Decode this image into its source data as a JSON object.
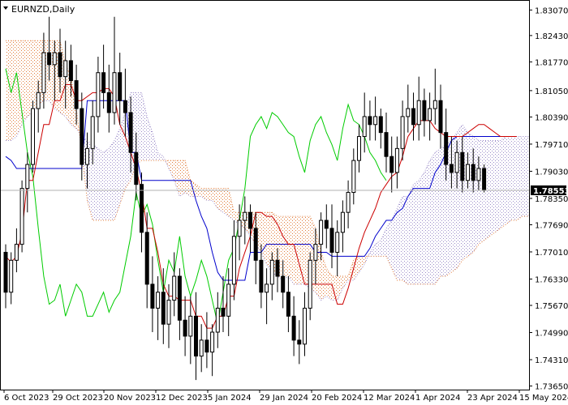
{
  "chart_data": {
    "type": "line",
    "title": "EURNZD,Daily",
    "symbol": "EURNZD",
    "timeframe": "Daily",
    "ylim": [
      1.7356,
      1.833
    ],
    "y_ticks": [
      "1.83070",
      "1.82430",
      "1.81770",
      "1.81050",
      "1.80390",
      "1.79710",
      "1.79030",
      "1.78350",
      "1.77690",
      "1.77010",
      "1.76330",
      "1.75670",
      "1.74990",
      "1.74310",
      "1.73650"
    ],
    "x_ticks": [
      "6 Oct 2023",
      "29 Oct 2023",
      "20 Nov 2023",
      "12 Dec 2023",
      "5 Jan 2024",
      "29 Jan 2024",
      "20 Feb 2024",
      "12 Mar 2024",
      "1 Apr 2024",
      "23 Apr 2024",
      "15 May 2024"
    ],
    "current_price": "1.78553",
    "colors": {
      "candle": "#000000",
      "tenkan_sen": "#cc0000",
      "kijun_sen": "#0000cc",
      "chikou_span": "#00cc00",
      "cloud_up": "#e07b39",
      "cloud_down": "#9a8ac8",
      "price_line": "#b0b0b0",
      "price_label_bg": "#000000"
    },
    "series": [
      {
        "key": "tenkan_sen",
        "values": [
          1.769,
          1.7675,
          1.769,
          1.775,
          1.788,
          1.788,
          1.795,
          1.802,
          1.802,
          1.808,
          1.808,
          1.812,
          1.812,
          1.808,
          1.808,
          1.809,
          1.81,
          1.81,
          1.811,
          1.811,
          1.809,
          1.802,
          1.799,
          1.795,
          1.791,
          1.785,
          1.776,
          1.776,
          1.77,
          1.762,
          1.759,
          1.759,
          1.758,
          1.758,
          1.758,
          1.754,
          1.754,
          1.751,
          1.751,
          1.754,
          1.754,
          1.759,
          1.759,
          1.766,
          1.77,
          1.774,
          1.78,
          1.78,
          1.779,
          1.779,
          1.777,
          1.774,
          1.772,
          1.772,
          1.767,
          1.762,
          1.762,
          1.762,
          1.762,
          1.762,
          1.762,
          1.757,
          1.757,
          1.761,
          1.766,
          1.771,
          1.775,
          1.778,
          1.781,
          1.785,
          1.787,
          1.789,
          1.79,
          1.794,
          1.799,
          1.801,
          1.803,
          1.803,
          1.803,
          1.801,
          1.8,
          1.799,
          1.799,
          1.799,
          1.799,
          1.8,
          1.801,
          1.802,
          1.802,
          1.801,
          1.8,
          1.799,
          1.799,
          1.799,
          1.799
        ]
      },
      {
        "key": "kijun_sen",
        "values": [
          1.794,
          1.793,
          1.791,
          1.791,
          1.791,
          1.791,
          1.791,
          1.791,
          1.791,
          1.791,
          1.791,
          1.791,
          1.791,
          1.791,
          1.791,
          1.808,
          1.808,
          1.808,
          1.808,
          1.808,
          1.808,
          1.808,
          1.808,
          1.795,
          1.795,
          1.788,
          1.788,
          1.788,
          1.788,
          1.788,
          1.788,
          1.788,
          1.788,
          1.788,
          1.788,
          1.783,
          1.779,
          1.776,
          1.77,
          1.765,
          1.763,
          1.763,
          1.763,
          1.763,
          1.763,
          1.77,
          1.77,
          1.77,
          1.772,
          1.772,
          1.772,
          1.772,
          1.772,
          1.772,
          1.772,
          1.772,
          1.772,
          1.77,
          1.77,
          1.77,
          1.769,
          1.769,
          1.769,
          1.769,
          1.769,
          1.769,
          1.769,
          1.771,
          1.774,
          1.776,
          1.778,
          1.778,
          1.78,
          1.781,
          1.784,
          1.786,
          1.786,
          1.786,
          1.786,
          1.79,
          1.792,
          1.795,
          1.798,
          1.799,
          1.799,
          1.799,
          1.799,
          1.799,
          1.799,
          1.799,
          1.799,
          1.799,
          1.799,
          1.799,
          1.799
        ]
      },
      {
        "key": "chikou_span",
        "values": [
          1.816,
          1.81,
          1.815,
          1.805,
          1.795,
          1.789,
          1.776,
          1.764,
          1.757,
          1.758,
          1.762,
          1.754,
          1.758,
          1.762,
          1.76,
          1.754,
          1.754,
          1.757,
          1.76,
          1.755,
          1.758,
          1.76,
          1.767,
          1.774,
          1.785,
          1.779,
          1.782,
          1.777,
          1.768,
          1.76,
          1.768,
          1.765,
          1.774,
          1.764,
          1.759,
          1.763,
          1.768,
          1.764,
          1.758,
          1.752,
          1.76,
          1.768,
          1.771,
          1.778,
          1.786,
          1.799,
          1.802,
          1.804,
          1.801,
          1.805,
          1.804,
          1.802,
          1.8,
          1.799,
          1.794,
          1.79,
          1.798,
          1.802,
          1.804,
          1.8,
          1.797,
          1.793,
          1.801,
          1.807,
          1.803,
          1.802,
          1.799,
          1.795,
          1.793,
          1.79,
          1.788
        ]
      },
      {
        "key": "senkou_a",
        "values": [
          1.798,
          1.798,
          1.799,
          1.802,
          1.804,
          1.805,
          1.807,
          1.808,
          1.808,
          1.806,
          1.805,
          1.804,
          1.802,
          1.801,
          1.799,
          1.798,
          1.797,
          1.796,
          1.795,
          1.796,
          1.798,
          1.801,
          1.805,
          1.81,
          1.81,
          1.81,
          1.804,
          1.8,
          1.795,
          1.794,
          1.791,
          1.788,
          1.784,
          1.785,
          1.784,
          1.784,
          1.784,
          1.783,
          1.783,
          1.781,
          1.78,
          1.779,
          1.778,
          1.777,
          1.776,
          1.774,
          1.772,
          1.77,
          1.767,
          1.765,
          1.764,
          1.763,
          1.764,
          1.762,
          1.762,
          1.762,
          1.761,
          1.76,
          1.758,
          1.759,
          1.758,
          1.758,
          1.761,
          1.763,
          1.763,
          1.765,
          1.767,
          1.77,
          1.772,
          1.773,
          1.776,
          1.778,
          1.781,
          1.784,
          1.784,
          1.787,
          1.788,
          1.79,
          1.793,
          1.795,
          1.796,
          1.797,
          1.798,
          1.8,
          1.802,
          1.8,
          1.799,
          1.798,
          1.798,
          1.798,
          1.798,
          1.798,
          1.799,
          1.799,
          1.799,
          1.799,
          1.799,
          1.799,
          1.799,
          1.799,
          1.799,
          1.799,
          1.799,
          1.799,
          1.799,
          1.799,
          1.799,
          1.799
        ]
      },
      {
        "key": "senkou_b",
        "values": [
          1.823,
          1.823,
          1.823,
          1.823,
          1.823,
          1.823,
          1.823,
          1.823,
          1.823,
          1.823,
          1.823,
          1.817,
          1.814,
          1.806,
          1.795,
          1.783,
          1.778,
          1.778,
          1.778,
          1.778,
          1.778,
          1.782,
          1.786,
          1.788,
          1.792,
          1.793,
          1.793,
          1.793,
          1.793,
          1.793,
          1.793,
          1.793,
          1.793,
          1.793,
          1.788,
          1.787,
          1.786,
          1.786,
          1.786,
          1.786,
          1.786,
          1.786,
          1.78,
          1.78,
          1.78,
          1.78,
          1.78,
          1.78,
          1.78,
          1.78,
          1.779,
          1.779,
          1.779,
          1.779,
          1.779,
          1.779,
          1.779,
          1.776,
          1.77,
          1.766,
          1.764,
          1.764,
          1.764,
          1.764,
          1.768,
          1.769,
          1.769,
          1.769,
          1.769,
          1.769,
          1.769,
          1.766,
          1.763,
          1.763,
          1.762,
          1.762,
          1.762,
          1.762,
          1.762,
          1.762,
          1.764,
          1.764,
          1.765,
          1.766,
          1.768,
          1.769,
          1.77,
          1.772,
          1.773,
          1.774,
          1.775,
          1.776,
          1.777,
          1.778,
          1.778,
          1.779,
          1.779,
          1.78,
          1.78,
          1.781,
          1.78,
          1.779,
          1.778,
          1.778,
          1.778,
          1.778,
          1.778,
          1.778
        ]
      }
    ],
    "candles": [
      [
        1.77,
        1.772,
        1.756,
        1.76
      ],
      [
        1.76,
        1.77,
        1.757,
        1.768
      ],
      [
        1.768,
        1.776,
        1.765,
        1.772
      ],
      [
        1.772,
        1.788,
        1.77,
        1.786
      ],
      [
        1.786,
        1.795,
        1.78,
        1.792
      ],
      [
        1.792,
        1.808,
        1.79,
        1.806
      ],
      [
        1.806,
        1.813,
        1.8,
        1.81
      ],
      [
        1.81,
        1.825,
        1.806,
        1.82
      ],
      [
        1.82,
        1.829,
        1.813,
        1.817
      ],
      [
        1.817,
        1.823,
        1.808,
        1.82
      ],
      [
        1.82,
        1.826,
        1.81,
        1.814
      ],
      [
        1.814,
        1.823,
        1.806,
        1.818
      ],
      [
        1.818,
        1.822,
        1.809,
        1.813
      ],
      [
        1.813,
        1.817,
        1.802,
        1.806
      ],
      [
        1.806,
        1.81,
        1.788,
        1.792
      ],
      [
        1.792,
        1.8,
        1.786,
        1.796
      ],
      [
        1.796,
        1.808,
        1.792,
        1.804
      ],
      [
        1.804,
        1.819,
        1.8,
        1.815
      ],
      [
        1.815,
        1.822,
        1.806,
        1.81
      ],
      [
        1.81,
        1.817,
        1.8,
        1.805
      ],
      [
        1.805,
        1.829,
        1.802,
        1.815
      ],
      [
        1.815,
        1.82,
        1.802,
        1.808
      ],
      [
        1.808,
        1.816,
        1.799,
        1.805
      ],
      [
        1.805,
        1.809,
        1.79,
        1.795
      ],
      [
        1.795,
        1.8,
        1.783,
        1.787
      ],
      [
        1.787,
        1.79,
        1.77,
        1.775
      ],
      [
        1.775,
        1.78,
        1.756,
        1.762
      ],
      [
        1.762,
        1.769,
        1.75,
        1.756
      ],
      [
        1.756,
        1.764,
        1.748,
        1.76
      ],
      [
        1.76,
        1.766,
        1.747,
        1.752
      ],
      [
        1.752,
        1.762,
        1.746,
        1.758
      ],
      [
        1.758,
        1.77,
        1.754,
        1.764
      ],
      [
        1.764,
        1.766,
        1.748,
        1.753
      ],
      [
        1.753,
        1.759,
        1.744,
        1.749
      ],
      [
        1.749,
        1.759,
        1.742,
        1.754
      ],
      [
        1.754,
        1.76,
        1.738,
        1.744
      ],
      [
        1.744,
        1.752,
        1.74,
        1.748
      ],
      [
        1.748,
        1.755,
        1.741,
        1.745
      ],
      [
        1.745,
        1.752,
        1.739,
        1.75
      ],
      [
        1.75,
        1.76,
        1.746,
        1.756
      ],
      [
        1.756,
        1.764,
        1.75,
        1.754
      ],
      [
        1.754,
        1.766,
        1.749,
        1.762
      ],
      [
        1.762,
        1.778,
        1.758,
        1.774
      ],
      [
        1.774,
        1.782,
        1.768,
        1.778
      ],
      [
        1.778,
        1.784,
        1.772,
        1.78
      ],
      [
        1.78,
        1.782,
        1.77,
        1.776
      ],
      [
        1.776,
        1.78,
        1.762,
        1.768
      ],
      [
        1.768,
        1.772,
        1.756,
        1.76
      ],
      [
        1.76,
        1.766,
        1.752,
        1.762
      ],
      [
        1.762,
        1.77,
        1.758,
        1.768
      ],
      [
        1.768,
        1.771,
        1.76,
        1.764
      ],
      [
        1.764,
        1.768,
        1.756,
        1.76
      ],
      [
        1.76,
        1.764,
        1.75,
        1.754
      ],
      [
        1.754,
        1.759,
        1.744,
        1.748
      ],
      [
        1.748,
        1.753,
        1.742,
        1.747
      ],
      [
        1.747,
        1.76,
        1.744,
        1.756
      ],
      [
        1.756,
        1.77,
        1.753,
        1.768
      ],
      [
        1.768,
        1.776,
        1.762,
        1.772
      ],
      [
        1.772,
        1.78,
        1.768,
        1.778
      ],
      [
        1.778,
        1.782,
        1.771,
        1.776
      ],
      [
        1.776,
        1.782,
        1.766,
        1.77
      ],
      [
        1.77,
        1.778,
        1.764,
        1.775
      ],
      [
        1.775,
        1.783,
        1.77,
        1.78
      ],
      [
        1.78,
        1.788,
        1.776,
        1.785
      ],
      [
        1.785,
        1.796,
        1.782,
        1.793
      ],
      [
        1.793,
        1.802,
        1.79,
        1.799
      ],
      [
        1.799,
        1.81,
        1.795,
        1.804
      ],
      [
        1.804,
        1.808,
        1.798,
        1.802
      ],
      [
        1.802,
        1.809,
        1.798,
        1.804
      ],
      [
        1.804,
        1.806,
        1.796,
        1.8
      ],
      [
        1.8,
        1.805,
        1.79,
        1.794
      ],
      [
        1.794,
        1.799,
        1.785,
        1.79
      ],
      [
        1.79,
        1.799,
        1.786,
        1.796
      ],
      [
        1.796,
        1.808,
        1.793,
        1.804
      ],
      [
        1.804,
        1.812,
        1.8,
        1.806
      ],
      [
        1.806,
        1.81,
        1.798,
        1.802
      ],
      [
        1.802,
        1.814,
        1.798,
        1.808
      ],
      [
        1.808,
        1.811,
        1.799,
        1.803
      ],
      [
        1.803,
        1.81,
        1.798,
        1.806
      ],
      [
        1.806,
        1.816,
        1.802,
        1.808
      ],
      [
        1.808,
        1.812,
        1.796,
        1.8
      ],
      [
        1.8,
        1.806,
        1.788,
        1.792
      ],
      [
        1.792,
        1.799,
        1.786,
        1.79
      ],
      [
        1.79,
        1.798,
        1.786,
        1.795
      ],
      [
        1.795,
        1.799,
        1.785,
        1.788
      ],
      [
        1.788,
        1.795,
        1.786,
        1.792
      ],
      [
        1.792,
        1.796,
        1.785,
        1.788
      ],
      [
        1.788,
        1.794,
        1.7855,
        1.791
      ],
      [
        1.791,
        1.792,
        1.785,
        1.7855
      ]
    ]
  }
}
